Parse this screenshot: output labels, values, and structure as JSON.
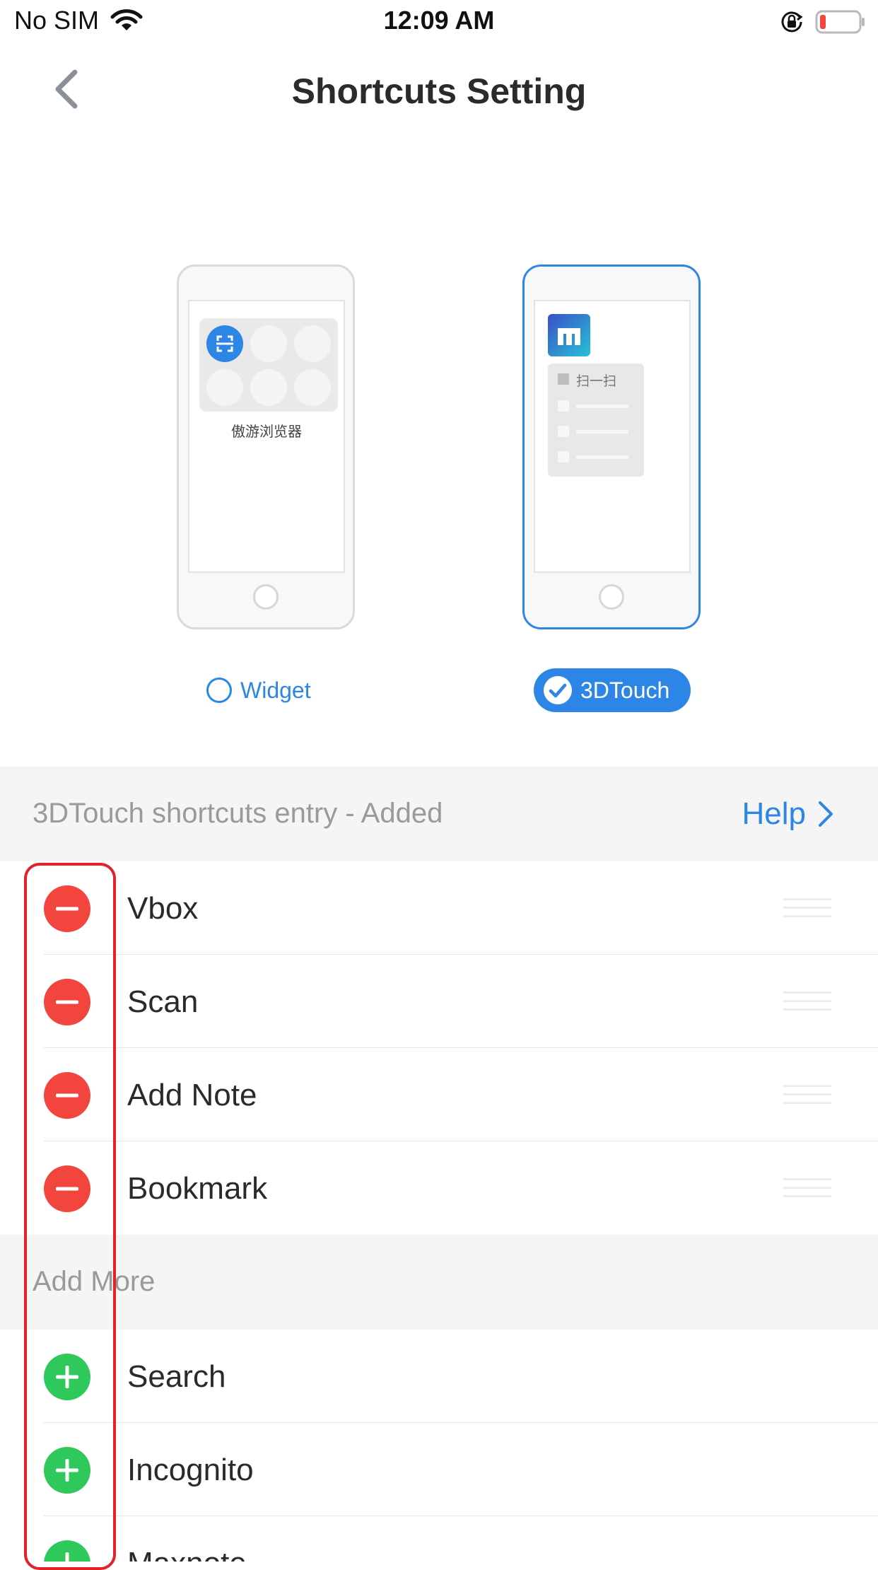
{
  "status_bar": {
    "carrier": "No SIM",
    "time": "12:09 AM"
  },
  "nav": {
    "title": "Shortcuts Setting"
  },
  "preview": {
    "widget_app_name": "傲游浏览器",
    "touch_menu_first": "扫一扫"
  },
  "modes": {
    "widget_label": "Widget",
    "touch_label": "3DTouch",
    "selected": "3DTouch"
  },
  "added_section": {
    "header": "3DTouch shortcuts entry - Added",
    "help_label": "Help",
    "items": [
      "Vbox",
      "Scan",
      "Add Note",
      "Bookmark"
    ]
  },
  "more_section": {
    "header": "Add More",
    "items": [
      "Search",
      "Incognito",
      "Maxnote"
    ]
  },
  "colors": {
    "accent": "#2d86e6",
    "remove": "#f2453d",
    "add": "#2fc85a",
    "highlight": "#e5202a"
  }
}
